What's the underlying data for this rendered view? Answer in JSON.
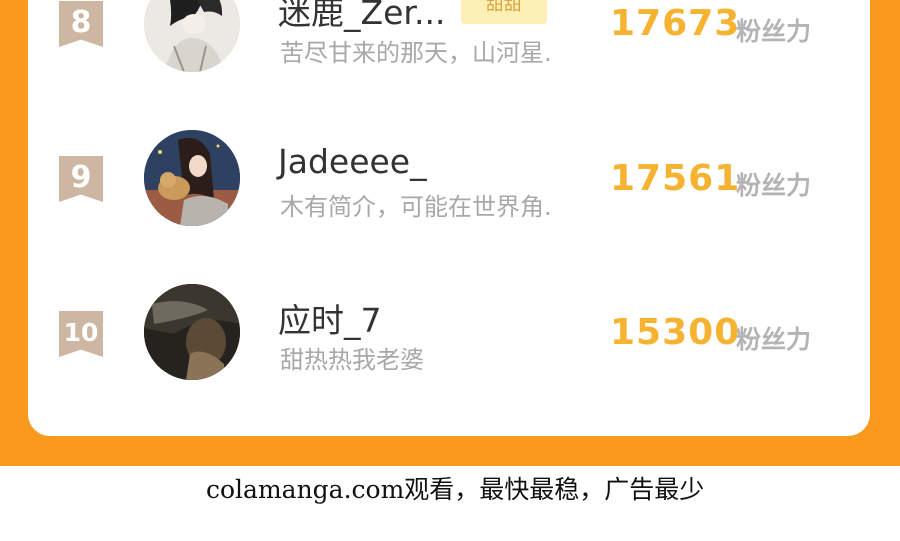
{
  "ranking": {
    "rows": [
      {
        "rank": "8",
        "name": "迷鹿_Zer...",
        "badge": "甜甜",
        "bio": "苦尽甘来的那天，山河星.",
        "score": "17673",
        "unit": "粉丝力",
        "avatar_icon": "anime-girl-avatar"
      },
      {
        "rank": "9",
        "name": "Jadeeee_",
        "bio": "木有简介，可能在世界角.",
        "score": "17561",
        "unit": "粉丝力",
        "avatar_icon": "anime-girl-with-cat-avatar"
      },
      {
        "rank": "10",
        "name": "应时_7",
        "bio": "甜热热我老婆",
        "score": "15300",
        "unit": "粉丝力",
        "avatar_icon": "dark-photo-avatar"
      }
    ]
  },
  "footer": {
    "text": "colamanga.com观看，最快最稳，广告最少"
  },
  "colors": {
    "frame_orange": "#f99a1e",
    "score_gold": "#f6b331",
    "rank_badge": "#cdb7a3",
    "badge_bg": "#fdf0b4"
  }
}
